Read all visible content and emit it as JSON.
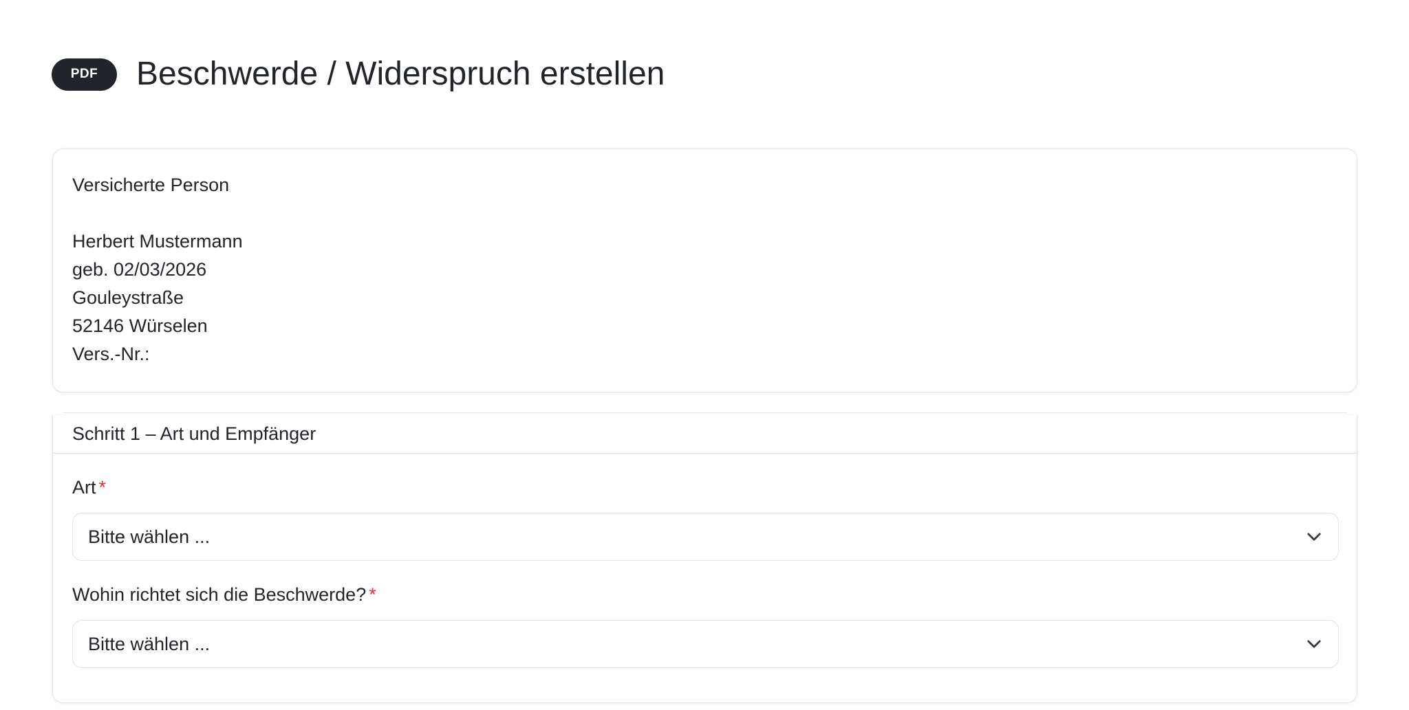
{
  "header": {
    "badge": "PDF",
    "title": "Beschwerde / Widerspruch erstellen"
  },
  "person": {
    "heading": "Versicherte Person",
    "name": "Herbert Mustermann",
    "birth": "geb. 02/03/2026",
    "street": "Gouleystraße",
    "city": "52146 Würselen",
    "insurance_no": "Vers.-Nr.:"
  },
  "step1": {
    "title": "Schritt 1 – Art und Empfänger",
    "fields": [
      {
        "label": "Art",
        "required": "*",
        "value": "Bitte wählen ..."
      },
      {
        "label": "Wohin richtet sich die Beschwerde?",
        "required": "*",
        "value": "Bitte wählen ..."
      }
    ]
  },
  "colors": {
    "text": "#212529",
    "badge_bg": "#212529",
    "required": "#dc3545",
    "border": "#dee2e6"
  }
}
